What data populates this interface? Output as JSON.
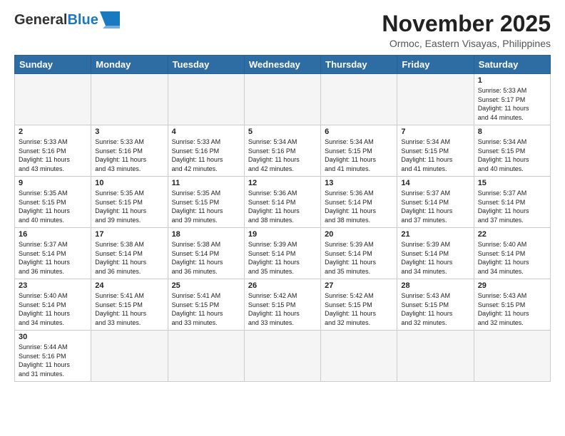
{
  "header": {
    "logo_general": "General",
    "logo_blue": "Blue",
    "month_title": "November 2025",
    "location": "Ormoc, Eastern Visayas, Philippines"
  },
  "weekdays": [
    "Sunday",
    "Monday",
    "Tuesday",
    "Wednesday",
    "Thursday",
    "Friday",
    "Saturday"
  ],
  "weeks": [
    [
      {
        "day": "",
        "info": ""
      },
      {
        "day": "",
        "info": ""
      },
      {
        "day": "",
        "info": ""
      },
      {
        "day": "",
        "info": ""
      },
      {
        "day": "",
        "info": ""
      },
      {
        "day": "",
        "info": ""
      },
      {
        "day": "1",
        "info": "Sunrise: 5:33 AM\nSunset: 5:17 PM\nDaylight: 11 hours\nand 44 minutes."
      }
    ],
    [
      {
        "day": "2",
        "info": "Sunrise: 5:33 AM\nSunset: 5:16 PM\nDaylight: 11 hours\nand 43 minutes."
      },
      {
        "day": "3",
        "info": "Sunrise: 5:33 AM\nSunset: 5:16 PM\nDaylight: 11 hours\nand 43 minutes."
      },
      {
        "day": "4",
        "info": "Sunrise: 5:33 AM\nSunset: 5:16 PM\nDaylight: 11 hours\nand 42 minutes."
      },
      {
        "day": "5",
        "info": "Sunrise: 5:34 AM\nSunset: 5:16 PM\nDaylight: 11 hours\nand 42 minutes."
      },
      {
        "day": "6",
        "info": "Sunrise: 5:34 AM\nSunset: 5:15 PM\nDaylight: 11 hours\nand 41 minutes."
      },
      {
        "day": "7",
        "info": "Sunrise: 5:34 AM\nSunset: 5:15 PM\nDaylight: 11 hours\nand 41 minutes."
      },
      {
        "day": "8",
        "info": "Sunrise: 5:34 AM\nSunset: 5:15 PM\nDaylight: 11 hours\nand 40 minutes."
      }
    ],
    [
      {
        "day": "9",
        "info": "Sunrise: 5:35 AM\nSunset: 5:15 PM\nDaylight: 11 hours\nand 40 minutes."
      },
      {
        "day": "10",
        "info": "Sunrise: 5:35 AM\nSunset: 5:15 PM\nDaylight: 11 hours\nand 39 minutes."
      },
      {
        "day": "11",
        "info": "Sunrise: 5:35 AM\nSunset: 5:15 PM\nDaylight: 11 hours\nand 39 minutes."
      },
      {
        "day": "12",
        "info": "Sunrise: 5:36 AM\nSunset: 5:14 PM\nDaylight: 11 hours\nand 38 minutes."
      },
      {
        "day": "13",
        "info": "Sunrise: 5:36 AM\nSunset: 5:14 PM\nDaylight: 11 hours\nand 38 minutes."
      },
      {
        "day": "14",
        "info": "Sunrise: 5:37 AM\nSunset: 5:14 PM\nDaylight: 11 hours\nand 37 minutes."
      },
      {
        "day": "15",
        "info": "Sunrise: 5:37 AM\nSunset: 5:14 PM\nDaylight: 11 hours\nand 37 minutes."
      }
    ],
    [
      {
        "day": "16",
        "info": "Sunrise: 5:37 AM\nSunset: 5:14 PM\nDaylight: 11 hours\nand 36 minutes."
      },
      {
        "day": "17",
        "info": "Sunrise: 5:38 AM\nSunset: 5:14 PM\nDaylight: 11 hours\nand 36 minutes."
      },
      {
        "day": "18",
        "info": "Sunrise: 5:38 AM\nSunset: 5:14 PM\nDaylight: 11 hours\nand 36 minutes."
      },
      {
        "day": "19",
        "info": "Sunrise: 5:39 AM\nSunset: 5:14 PM\nDaylight: 11 hours\nand 35 minutes."
      },
      {
        "day": "20",
        "info": "Sunrise: 5:39 AM\nSunset: 5:14 PM\nDaylight: 11 hours\nand 35 minutes."
      },
      {
        "day": "21",
        "info": "Sunrise: 5:39 AM\nSunset: 5:14 PM\nDaylight: 11 hours\nand 34 minutes."
      },
      {
        "day": "22",
        "info": "Sunrise: 5:40 AM\nSunset: 5:14 PM\nDaylight: 11 hours\nand 34 minutes."
      }
    ],
    [
      {
        "day": "23",
        "info": "Sunrise: 5:40 AM\nSunset: 5:14 PM\nDaylight: 11 hours\nand 34 minutes."
      },
      {
        "day": "24",
        "info": "Sunrise: 5:41 AM\nSunset: 5:15 PM\nDaylight: 11 hours\nand 33 minutes."
      },
      {
        "day": "25",
        "info": "Sunrise: 5:41 AM\nSunset: 5:15 PM\nDaylight: 11 hours\nand 33 minutes."
      },
      {
        "day": "26",
        "info": "Sunrise: 5:42 AM\nSunset: 5:15 PM\nDaylight: 11 hours\nand 33 minutes."
      },
      {
        "day": "27",
        "info": "Sunrise: 5:42 AM\nSunset: 5:15 PM\nDaylight: 11 hours\nand 32 minutes."
      },
      {
        "day": "28",
        "info": "Sunrise: 5:43 AM\nSunset: 5:15 PM\nDaylight: 11 hours\nand 32 minutes."
      },
      {
        "day": "29",
        "info": "Sunrise: 5:43 AM\nSunset: 5:15 PM\nDaylight: 11 hours\nand 32 minutes."
      }
    ],
    [
      {
        "day": "30",
        "info": "Sunrise: 5:44 AM\nSunset: 5:16 PM\nDaylight: 11 hours\nand 31 minutes."
      },
      {
        "day": "",
        "info": ""
      },
      {
        "day": "",
        "info": ""
      },
      {
        "day": "",
        "info": ""
      },
      {
        "day": "",
        "info": ""
      },
      {
        "day": "",
        "info": ""
      },
      {
        "day": "",
        "info": ""
      }
    ]
  ]
}
